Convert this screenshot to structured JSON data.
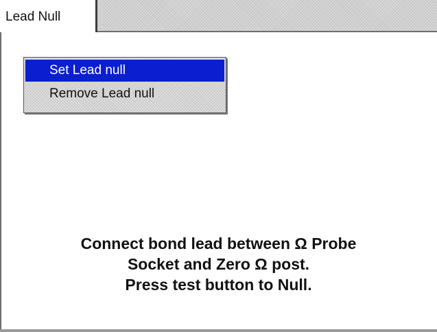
{
  "tabs": [
    {
      "label": "Lead Null",
      "active": true
    }
  ],
  "menu": {
    "items": [
      {
        "label": "Set Lead null",
        "selected": true
      },
      {
        "label": "Remove Lead null",
        "selected": false
      }
    ]
  },
  "instructions": {
    "lines": [
      "Connect bond lead between Ω Probe",
      "Socket and Zero Ω post.",
      "Press test button to Null."
    ]
  },
  "colors": {
    "selection": "#0b1fd0",
    "menu_background": "#d4d4d4",
    "tab_strip": "#cfcfcf"
  }
}
